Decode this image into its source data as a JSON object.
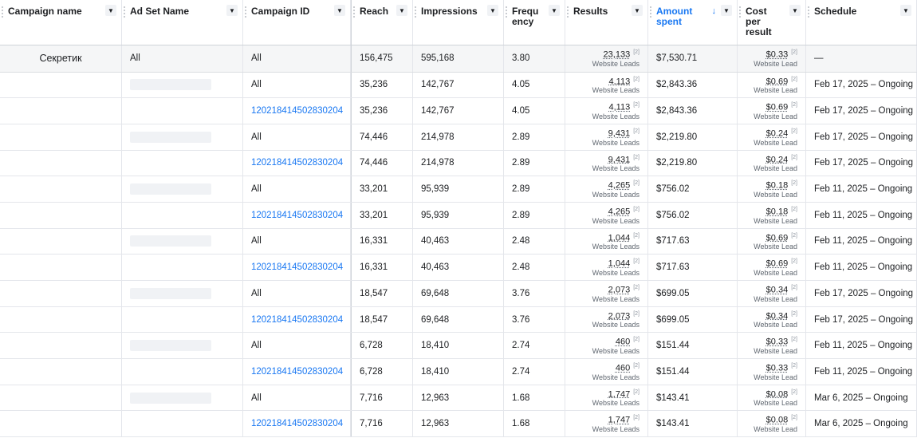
{
  "headers": {
    "campaign_name": "Campaign name",
    "ad_set_name": "Ad Set Name",
    "campaign_id": "Campaign ID",
    "reach": "Reach",
    "impressions": "Impressions",
    "frequency_1": "Frequ",
    "frequency_2": "ency",
    "results": "Results",
    "amount_1": "Amount",
    "amount_2": "spent",
    "cost_1": "Cost",
    "cost_2": "per",
    "cost_3": "result",
    "schedule": "Schedule"
  },
  "summary": {
    "campaign_name": "Секретик",
    "ad_set_name": "All",
    "campaign_id": "All",
    "reach": "156,475",
    "impressions": "595,168",
    "frequency": "3.80",
    "results": "23,133",
    "results_sup": "[2]",
    "results_sub": "Website Leads",
    "amount": "$7,530.71",
    "cost": "$0.33",
    "cost_sup": "[2]",
    "cost_sub": "Website Lead",
    "schedule": "—"
  },
  "rows": [
    {
      "campaign_id": "All",
      "reach": "35,236",
      "impressions": "142,767",
      "frequency": "4.05",
      "results": "4,113",
      "results_sup": "[2]",
      "results_sub": "Website Leads",
      "amount": "$2,843.36",
      "cost": "$0.69",
      "cost_sup": "[2]",
      "cost_sub": "Website Lead",
      "schedule": "Feb 17, 2025 – Ongoing"
    },
    {
      "campaign_id": "120218414502830204",
      "reach": "35,236",
      "impressions": "142,767",
      "frequency": "4.05",
      "results": "4,113",
      "results_sup": "[2]",
      "results_sub": "Website Leads",
      "amount": "$2,843.36",
      "cost": "$0.69",
      "cost_sup": "[2]",
      "cost_sub": "Website Lead",
      "schedule": "Feb 17, 2025 – Ongoing"
    },
    {
      "campaign_id": "All",
      "reach": "74,446",
      "impressions": "214,978",
      "frequency": "2.89",
      "results": "9,431",
      "results_sup": "[2]",
      "results_sub": "Website Leads",
      "amount": "$2,219.80",
      "cost": "$0.24",
      "cost_sup": "[2]",
      "cost_sub": "Website Lead",
      "schedule": "Feb 17, 2025 – Ongoing"
    },
    {
      "campaign_id": "120218414502830204",
      "reach": "74,446",
      "impressions": "214,978",
      "frequency": "2.89",
      "results": "9,431",
      "results_sup": "[2]",
      "results_sub": "Website Leads",
      "amount": "$2,219.80",
      "cost": "$0.24",
      "cost_sup": "[2]",
      "cost_sub": "Website Lead",
      "schedule": "Feb 17, 2025 – Ongoing"
    },
    {
      "campaign_id": "All",
      "reach": "33,201",
      "impressions": "95,939",
      "frequency": "2.89",
      "results": "4,265",
      "results_sup": "[2]",
      "results_sub": "Website Leads",
      "amount": "$756.02",
      "cost": "$0.18",
      "cost_sup": "[2]",
      "cost_sub": "Website Lead",
      "schedule": "Feb 11, 2025 – Ongoing"
    },
    {
      "campaign_id": "120218414502830204",
      "reach": "33,201",
      "impressions": "95,939",
      "frequency": "2.89",
      "results": "4,265",
      "results_sup": "[2]",
      "results_sub": "Website Leads",
      "amount": "$756.02",
      "cost": "$0.18",
      "cost_sup": "[2]",
      "cost_sub": "Website Lead",
      "schedule": "Feb 11, 2025 – Ongoing"
    },
    {
      "campaign_id": "All",
      "reach": "16,331",
      "impressions": "40,463",
      "frequency": "2.48",
      "results": "1,044",
      "results_sup": "[2]",
      "results_sub": "Website Leads",
      "amount": "$717.63",
      "cost": "$0.69",
      "cost_sup": "[2]",
      "cost_sub": "Website Lead",
      "schedule": "Feb 11, 2025 – Ongoing"
    },
    {
      "campaign_id": "120218414502830204",
      "reach": "16,331",
      "impressions": "40,463",
      "frequency": "2.48",
      "results": "1,044",
      "results_sup": "[2]",
      "results_sub": "Website Leads",
      "amount": "$717.63",
      "cost": "$0.69",
      "cost_sup": "[2]",
      "cost_sub": "Website Lead",
      "schedule": "Feb 11, 2025 – Ongoing"
    },
    {
      "campaign_id": "All",
      "reach": "18,547",
      "impressions": "69,648",
      "frequency": "3.76",
      "results": "2,073",
      "results_sup": "[2]",
      "results_sub": "Website Leads",
      "amount": "$699.05",
      "cost": "$0.34",
      "cost_sup": "[2]",
      "cost_sub": "Website Lead",
      "schedule": "Feb 17, 2025 – Ongoing"
    },
    {
      "campaign_id": "120218414502830204",
      "reach": "18,547",
      "impressions": "69,648",
      "frequency": "3.76",
      "results": "2,073",
      "results_sup": "[2]",
      "results_sub": "Website Leads",
      "amount": "$699.05",
      "cost": "$0.34",
      "cost_sup": "[2]",
      "cost_sub": "Website Lead",
      "schedule": "Feb 17, 2025 – Ongoing"
    },
    {
      "campaign_id": "All",
      "reach": "6,728",
      "impressions": "18,410",
      "frequency": "2.74",
      "results": "460",
      "results_sup": "[2]",
      "results_sub": "Website Leads",
      "amount": "$151.44",
      "cost": "$0.33",
      "cost_sup": "[2]",
      "cost_sub": "Website Lead",
      "schedule": "Feb 11, 2025 – Ongoing"
    },
    {
      "campaign_id": "120218414502830204",
      "reach": "6,728",
      "impressions": "18,410",
      "frequency": "2.74",
      "results": "460",
      "results_sup": "[2]",
      "results_sub": "Website Leads",
      "amount": "$151.44",
      "cost": "$0.33",
      "cost_sup": "[2]",
      "cost_sub": "Website Lead",
      "schedule": "Feb 11, 2025 – Ongoing"
    },
    {
      "campaign_id": "All",
      "reach": "7,716",
      "impressions": "12,963",
      "frequency": "1.68",
      "results": "1,747",
      "results_sup": "[2]",
      "results_sub": "Website Leads",
      "amount": "$143.41",
      "cost": "$0.08",
      "cost_sup": "[2]",
      "cost_sub": "Website Lead",
      "schedule": "Mar 6, 2025 – Ongoing"
    },
    {
      "campaign_id": "120218414502830204",
      "reach": "7,716",
      "impressions": "12,963",
      "frequency": "1.68",
      "results": "1,747",
      "results_sup": "[2]",
      "results_sub": "Website Leads",
      "amount": "$143.41",
      "cost": "$0.08",
      "cost_sup": "[2]",
      "cost_sub": "Website Lead",
      "schedule": "Mar 6, 2025 – Ongoing"
    }
  ]
}
